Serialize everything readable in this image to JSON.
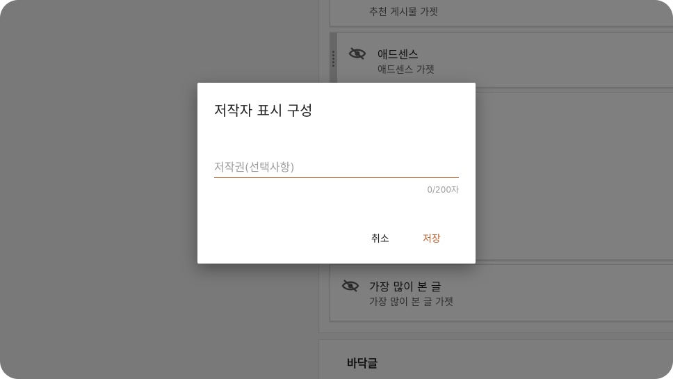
{
  "background": {
    "gadgets": [
      {
        "title": "",
        "subtitle": "추천 게시물 가젯"
      },
      {
        "title": "애드센스",
        "subtitle": "애드센스 가젯"
      },
      {
        "title": "가장 많이 본 글",
        "subtitle": "가장 많이 본 글 가젯"
      }
    ],
    "footer_label": "바닥글"
  },
  "dialog": {
    "title": "저작자 표시 구성",
    "input_placeholder": "저작권(선택사항)",
    "input_value": "",
    "counter": "0/200자",
    "cancel_label": "취소",
    "save_label": "저장"
  },
  "colors": {
    "accent": "#c4622d",
    "overlay": "rgba(0,0,0,0.5)"
  },
  "icons": {
    "hidden_gadget": "eye-off-icon",
    "drag": "drag-handle-icon"
  }
}
